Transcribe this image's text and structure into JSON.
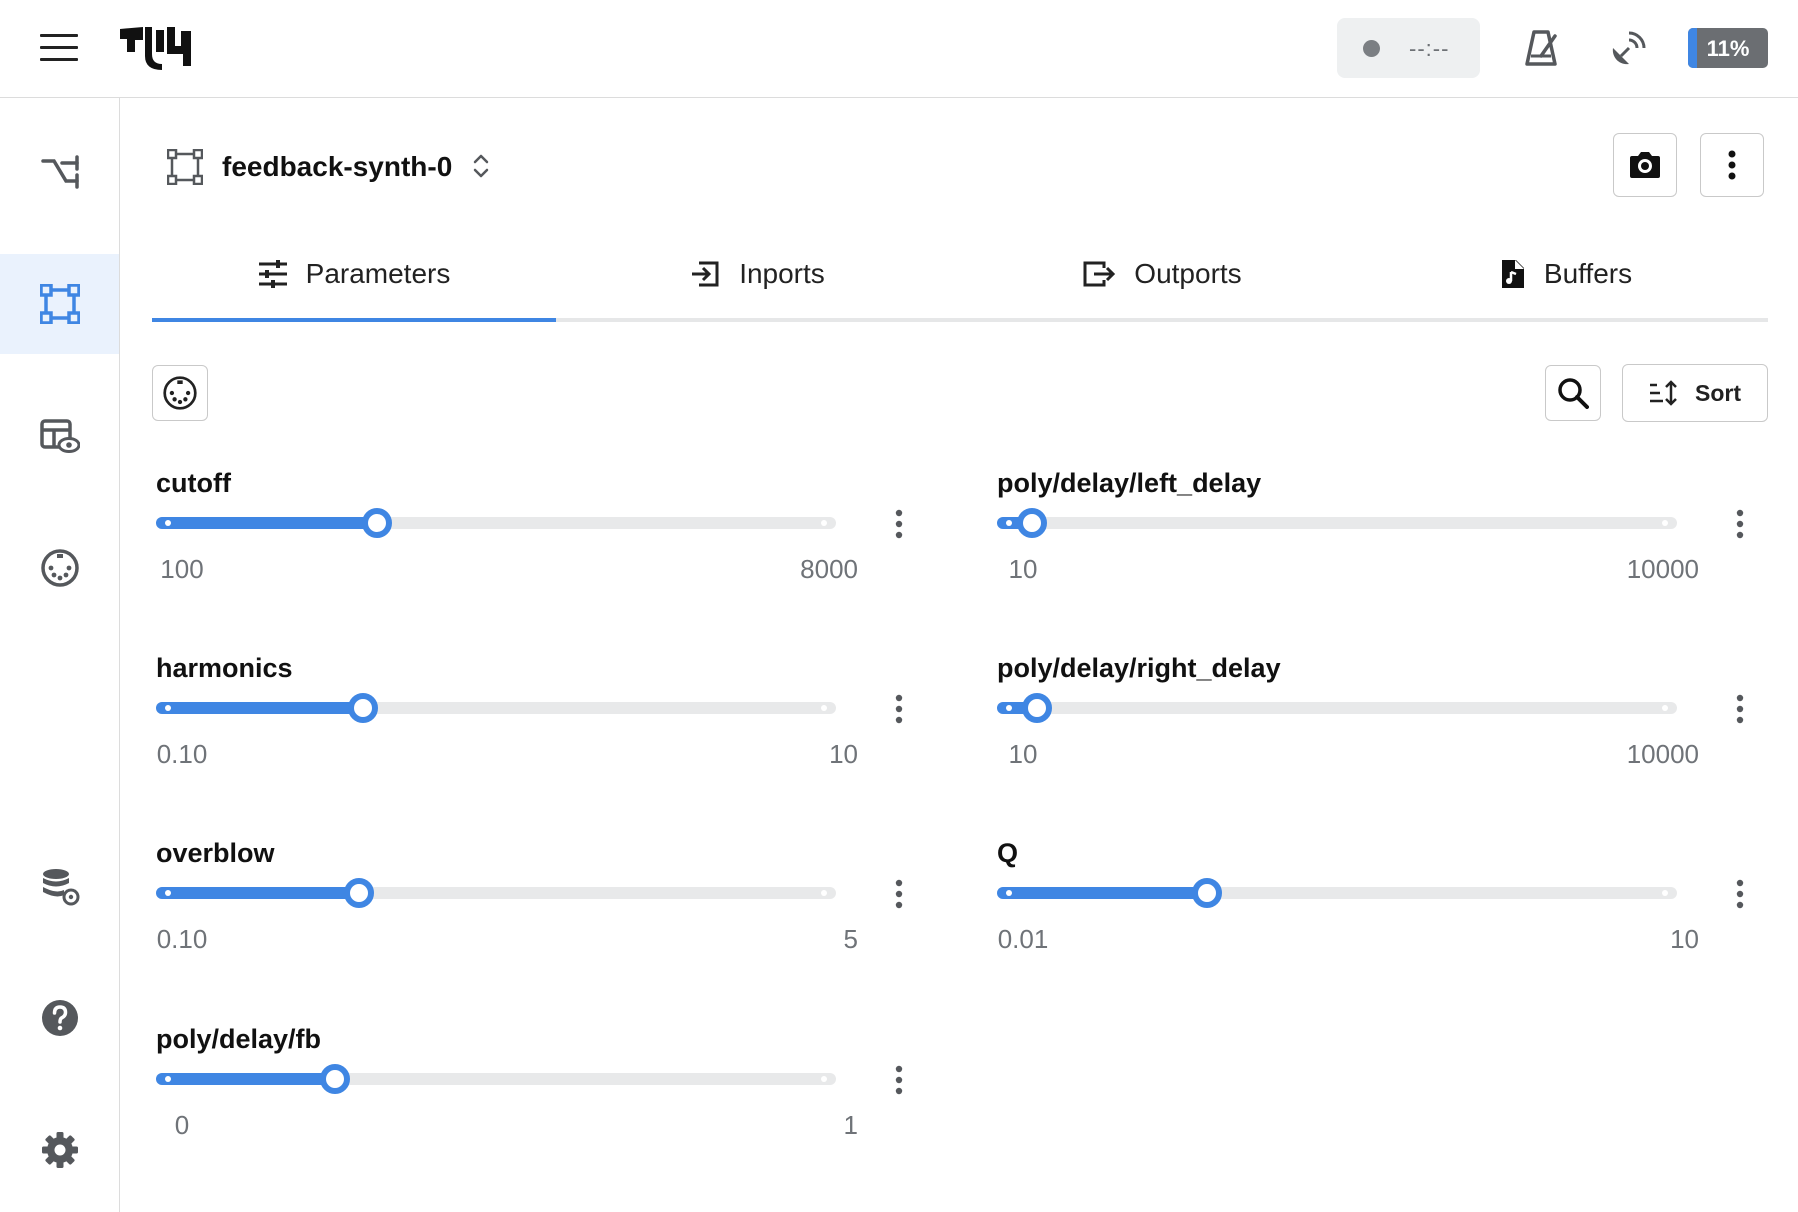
{
  "topbar": {
    "transport_time": "--:--",
    "cpu_label": "11%",
    "cpu_percent": 11
  },
  "sidebar": {
    "items": [
      {
        "name": "graph-editor",
        "icon": "patch-cable-icon",
        "active": false
      },
      {
        "name": "device-view",
        "icon": "device-frame-icon",
        "active": true
      },
      {
        "name": "parameter-view",
        "icon": "table-eye-icon",
        "active": false
      },
      {
        "name": "midi-view",
        "icon": "midi-port-icon",
        "active": false
      },
      {
        "name": "resources",
        "icon": "database-gear-icon",
        "active": false
      },
      {
        "name": "help",
        "icon": "help-circle-icon",
        "active": false
      },
      {
        "name": "settings",
        "icon": "gear-icon",
        "active": false
      }
    ]
  },
  "device": {
    "title": "feedback-synth-0"
  },
  "tabs": [
    {
      "label": "Parameters",
      "icon": "sliders-icon",
      "active": true
    },
    {
      "label": "Inports",
      "icon": "inport-icon",
      "active": false
    },
    {
      "label": "Outports",
      "icon": "outport-icon",
      "active": false
    },
    {
      "label": "Buffers",
      "icon": "audio-file-icon",
      "active": false
    }
  ],
  "toolbar": {
    "sort_label": "Sort"
  },
  "parameters": [
    {
      "name": "cutoff",
      "min": "100",
      "max": "8000",
      "fraction": 0.325
    },
    {
      "name": "harmonics",
      "min": "0.10",
      "max": "10",
      "fraction": 0.305
    },
    {
      "name": "overblow",
      "min": "0.10",
      "max": "5",
      "fraction": 0.298
    },
    {
      "name": "poly/delay/fb",
      "min": "0",
      "max": "1",
      "fraction": 0.263
    },
    {
      "name": "poly/delay/left_delay",
      "min": "10",
      "max": "10000",
      "fraction": 0.051
    },
    {
      "name": "poly/delay/right_delay",
      "min": "10",
      "max": "10000",
      "fraction": 0.059
    },
    {
      "name": "Q",
      "min": "0.01",
      "max": "10",
      "fraction": 0.309
    }
  ],
  "colors": {
    "accent": "#3f86e3",
    "active_sidebar_bg": "#eaf2fd",
    "track": "#e8e9ea",
    "cpu_bg": "#6b6e72"
  }
}
